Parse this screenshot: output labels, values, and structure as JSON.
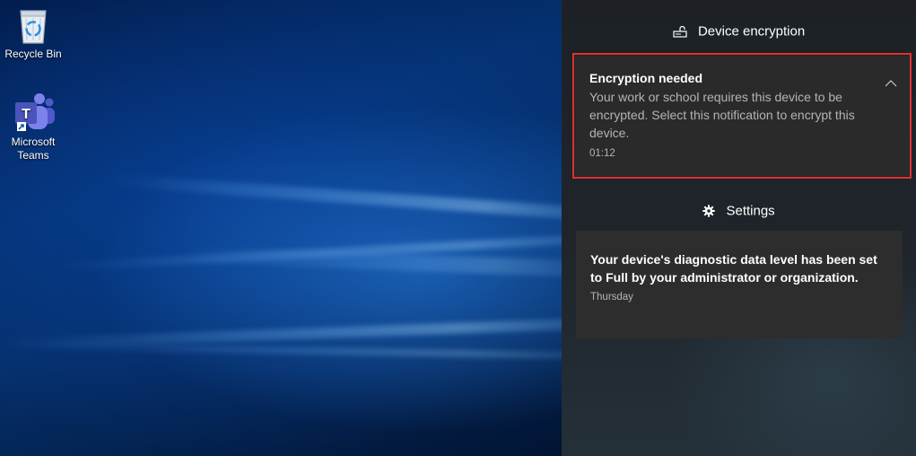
{
  "desktop": {
    "icons": [
      {
        "label": "Recycle Bin",
        "icon": "recycle-bin-icon"
      },
      {
        "label": "Microsoft Teams",
        "icon": "teams-icon"
      }
    ]
  },
  "action_center": {
    "groups": [
      {
        "header": "Device encryption",
        "icon": "encryption-icon",
        "notification": {
          "title": "Encryption needed",
          "body": "Your work or school requires this device to be encrypted. Select this notification to encrypt this device.",
          "time": "01:12",
          "highlight_color": "#e0302e"
        }
      },
      {
        "header": "Settings",
        "icon": "gear-icon",
        "notification": {
          "body": "Your device's diagnostic data level has been set to Full by your administrator or organization.",
          "time": "Thursday"
        }
      }
    ]
  }
}
